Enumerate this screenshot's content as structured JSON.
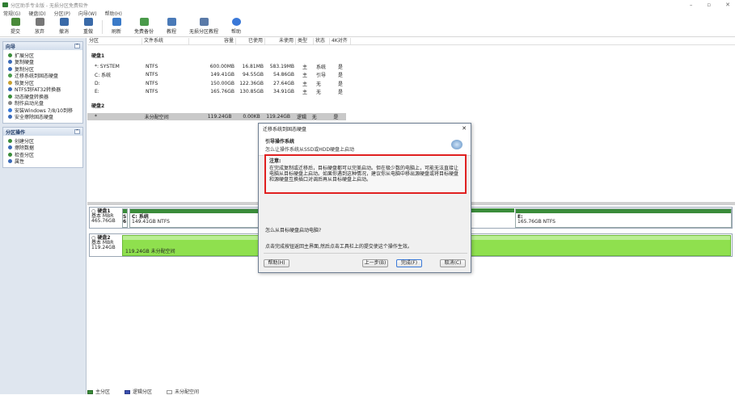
{
  "window": {
    "title": "分区助手专业版 - 无损分区免费软件",
    "controls": [
      "–",
      "▫",
      "✕"
    ]
  },
  "menu": [
    "常规(G)",
    "硬盘(D)",
    "分区(P)",
    "向导(W)",
    "帮助(H)"
  ],
  "toolbar": [
    {
      "label": "提交",
      "icon": "check-icon",
      "color": "#4a8a3a"
    },
    {
      "label": "放弃",
      "icon": "discard-icon",
      "color": "#777777"
    },
    {
      "label": "撤消",
      "icon": "undo-icon",
      "color": "#3a6aa8"
    },
    {
      "label": "重做",
      "icon": "redo-icon",
      "color": "#3a6aa8"
    },
    {
      "label": "刷新",
      "icon": "refresh-icon",
      "color": "#3a7ac8"
    },
    {
      "label": "免费备份",
      "icon": "backup-icon",
      "color": "#4a9a4a"
    },
    {
      "label": "教程",
      "icon": "tutorial-icon",
      "color": "#4a7ab8"
    },
    {
      "label": "无损分区教程",
      "icon": "partition-tutorial-icon",
      "color": "#5a7aa8"
    },
    {
      "label": "帮助",
      "icon": "help-icon",
      "color": "#3a78d8"
    }
  ],
  "sidebar": {
    "wizard": {
      "title": "向导",
      "items": [
        "扩展分区",
        "复制硬盘",
        "复制分区",
        "迁移系统到固态硬盘",
        "恢复分区",
        "NTFS到FAT32转换器",
        "动态硬盘转换器",
        "制作启动光盘",
        "安装Windows 7/8/10到移",
        "安全擦除固态硬盘"
      ]
    },
    "partition_ops": {
      "title": "分区操作",
      "items": [
        "创建分区",
        "擦除数据",
        "检查分区",
        "属性"
      ]
    }
  },
  "table": {
    "headers": [
      "分区",
      "文件系统",
      "容量",
      "已使用",
      "未使用",
      "类型",
      "状态",
      "4K对齐"
    ],
    "disk1_label": "硬盘1",
    "disk1_rows": [
      [
        "*: SYSTEM",
        "NTFS",
        "600.00MB",
        "16.81MB",
        "583.19MB",
        "主",
        "系统",
        "是"
      ],
      [
        "C: 系统",
        "NTFS",
        "149.41GB",
        "94.55GB",
        "54.86GB",
        "主",
        "引导",
        "是"
      ],
      [
        "D:",
        "NTFS",
        "150.00GB",
        "122.36GB",
        "27.64GB",
        "主",
        "无",
        "是"
      ],
      [
        "E:",
        "NTFS",
        "165.76GB",
        "130.85GB",
        "34.91GB",
        "主",
        "无",
        "是"
      ]
    ],
    "disk2_label": "硬盘2",
    "disk2_rows": [
      [
        "*",
        "未分配空间",
        "119.24GB",
        "0.00KB",
        "119.24GB",
        "逻辑",
        "无",
        "是"
      ]
    ]
  },
  "diskmap": {
    "disk1": {
      "name": "硬盘1",
      "type": "基本 MBR",
      "size": "465.76GB",
      "s_label": "S",
      "s_num": "6",
      "c_label": "C: 系统",
      "c_size": "149.41GB NTFS",
      "e_label": "E:",
      "e_size": "165.76GB NTFS"
    },
    "disk2": {
      "name": "硬盘2",
      "type": "基本 MBR",
      "size": "119.24GB",
      "unalloc": "119.24GB 未分配空间"
    }
  },
  "legend": [
    {
      "label": "主分区",
      "color": "#3a8c3a"
    },
    {
      "label": "逻辑分区",
      "color": "#3a4fb0"
    },
    {
      "label": "未分配空间",
      "color": "#ffffff"
    }
  ],
  "dialog": {
    "title": "迁移系统到固态硬盘",
    "close": "✕",
    "header_title": "引导操作系统",
    "header_sub": "怎么让操作系统从SSD或HDD硬盘上启动",
    "notice_title": "注意:",
    "notice_body": "在完成复制或迁移后，目标硬盘都可以完美启动。但在极少数的电脑上，可能无法直接让电脑从目标硬盘上启动。如果你遇到这种情况，建议你从电脑中移出源硬盘或将目标硬盘和源硬盘互换插口对调后再从目标硬盘上启动。",
    "question": "怎么从目标硬盘启动电脑?",
    "instruction": "点击完成按钮返回主界面,然后点击工具栏上的提交使这个操作生效。",
    "btn_help": "帮助(H)",
    "btn_back": "上一步(B)",
    "btn_finish": "完成(F)",
    "btn_cancel": "取消(C)"
  }
}
